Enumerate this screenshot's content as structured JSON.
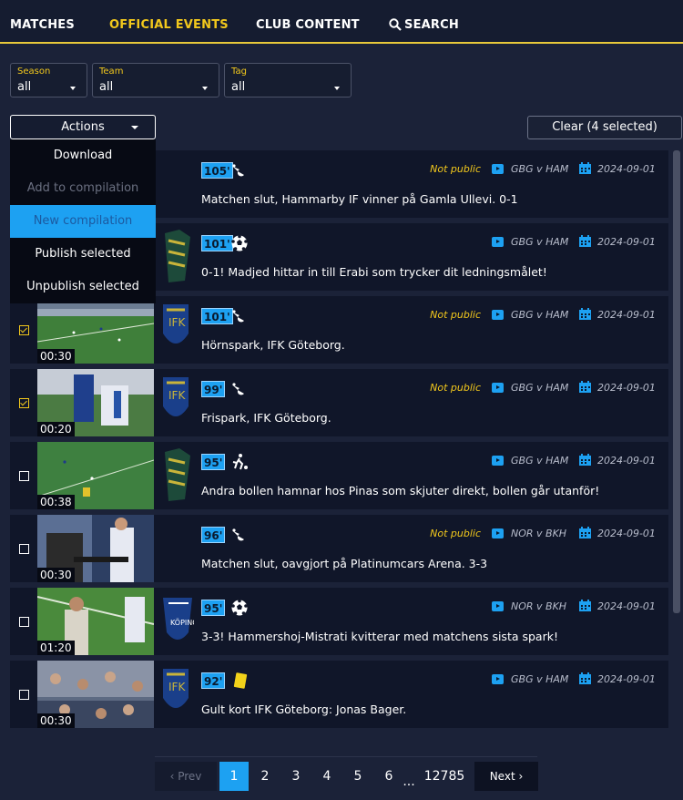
{
  "nav": {
    "tabs": [
      {
        "label": "MATCHES"
      },
      {
        "label": "OFFICIAL EVENTS",
        "active": true
      },
      {
        "label": "CLUB CONTENT"
      },
      {
        "label": "SEARCH",
        "icon": "search-icon"
      }
    ]
  },
  "filters": [
    {
      "label": "Season",
      "value": "all"
    },
    {
      "label": "Team",
      "value": "all"
    },
    {
      "label": "Tag",
      "value": "all"
    }
  ],
  "actions": {
    "label": "Actions",
    "menu": [
      {
        "label": "Download",
        "state": "enabled"
      },
      {
        "label": "Add to compilation",
        "state": "disabled"
      },
      {
        "label": "New compilation",
        "state": "highlighted"
      },
      {
        "label": "Publish selected",
        "state": "enabled"
      },
      {
        "label": "Unpublish selected",
        "state": "enabled"
      }
    ]
  },
  "clear_button": "Clear (4 selected)",
  "events": [
    {
      "checked": null,
      "duration": "",
      "minute": "105'",
      "event_icon": "whistle-icon",
      "not_public": "Not public",
      "match": "GBG v HAM",
      "date": "2024-09-01",
      "description": "Matchen slut, Hammarby IF vinner på Gamla Ullevi. 0-1"
    },
    {
      "checked": null,
      "duration": "",
      "minute": "101'",
      "event_icon": "football-icon",
      "not_public": "",
      "match": "GBG v HAM",
      "date": "2024-09-01",
      "description": "0-1! Madjed hittar in till Erabi som trycker dit ledningsmålet!"
    },
    {
      "checked": true,
      "duration": "00:30",
      "minute": "101'",
      "event_icon": "whistle-icon",
      "not_public": "Not public",
      "match": "GBG v HAM",
      "date": "2024-09-01",
      "description": "Hörnspark, IFK Göteborg."
    },
    {
      "checked": true,
      "duration": "00:20",
      "minute": "99'",
      "event_icon": "whistle-icon",
      "not_public": "Not public",
      "match": "GBG v HAM",
      "date": "2024-09-01",
      "description": "Frispark, IFK Göteborg."
    },
    {
      "checked": false,
      "duration": "00:38",
      "minute": "95'",
      "event_icon": "shot-icon",
      "not_public": "",
      "match": "GBG v HAM",
      "date": "2024-09-01",
      "description": "Andra bollen hamnar hos Pinas som skjuter direkt, bollen går utanför!"
    },
    {
      "checked": false,
      "duration": "00:30",
      "minute": "96'",
      "event_icon": "whistle-icon",
      "not_public": "Not public",
      "match": "NOR v BKH",
      "date": "2024-09-01",
      "description": "Matchen slut, oavgjort på Platinumcars Arena. 3-3"
    },
    {
      "checked": false,
      "duration": "01:20",
      "minute": "95'",
      "event_icon": "football-icon",
      "not_public": "",
      "match": "NOR v BKH",
      "date": "2024-09-01",
      "description": "3-3! Hammershoj-Mistrati kvitterar med matchens sista spark!"
    },
    {
      "checked": false,
      "duration": "00:30",
      "minute": "92'",
      "event_icon": "yellow-card-icon",
      "not_public": "",
      "match": "GBG v HAM",
      "date": "2024-09-01",
      "description": "Gult kort IFK Göteborg: Jonas Bager."
    }
  ],
  "pagination": {
    "prev": "Prev",
    "next": "Next",
    "pages": [
      "1",
      "2",
      "3",
      "4",
      "5",
      "6"
    ],
    "ellipsis": "...",
    "last": "12785",
    "current": "1"
  },
  "colors": {
    "accent": "#f2c81c",
    "primary": "#1da1f2",
    "background": "#1b2238"
  }
}
